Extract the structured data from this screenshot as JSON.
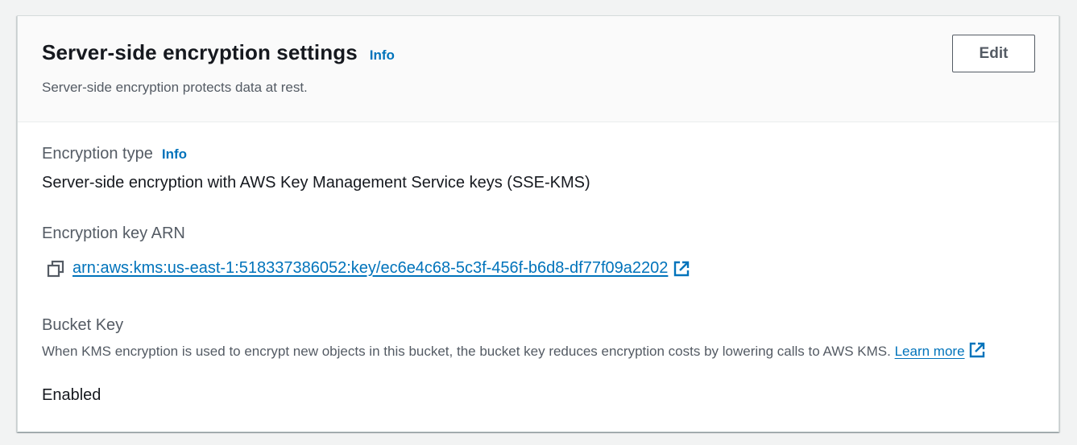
{
  "header": {
    "title": "Server-side encryption settings",
    "info_label": "Info",
    "description": "Server-side encryption protects data at rest.",
    "edit_label": "Edit"
  },
  "encryption_type": {
    "label": "Encryption type",
    "info_label": "Info",
    "value": "Server-side encryption with AWS Key Management Service keys (SSE-KMS)"
  },
  "encryption_key": {
    "label": "Encryption key ARN",
    "arn": "arn:aws:kms:us-east-1:518337386052:key/ec6e4c68-5c3f-456f-b6d8-df77f09a2202",
    "copy_icon": "copy-icon",
    "external_icon": "external-link-icon"
  },
  "bucket_key": {
    "label": "Bucket Key",
    "description": "When KMS encryption is used to encrypt new objects in this bucket, the bucket key reduces encryption costs by lowering calls to AWS KMS. ",
    "learn_more_label": "Learn more",
    "value": "Enabled"
  },
  "colors": {
    "link": "#0073bb",
    "text": "#16191f",
    "secondary_text": "#545b64",
    "header_bg": "#fafafa",
    "page_bg": "#f2f3f3"
  }
}
